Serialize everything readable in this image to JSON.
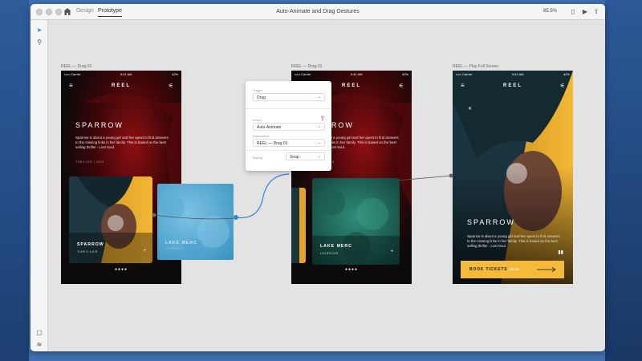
{
  "window": {
    "tabs": [
      {
        "label": "Design",
        "active": false
      },
      {
        "label": "Prototype",
        "active": true
      }
    ],
    "title": "Auto-Animate and Drag Gestures",
    "zoom": "85.5%"
  },
  "artboards": [
    {
      "label": "REEL — Drag 01"
    },
    {
      "label": "REEL — Drag 01"
    },
    {
      "label": "REEL — Play Full Screen"
    }
  ],
  "app": {
    "name": "REEL",
    "status_carrier": "••••• Carrier",
    "status_time": "9:41 AM",
    "status_battery": "42%",
    "hero_title": "SPARROW",
    "hero_description": "Sparrow is about a young girl and her quest to find answers to the missing links in her family. This is based on the best selling thriller - Lost Soul.",
    "hero_tag": "THRILLER | 2018",
    "cards": [
      {
        "title": "SPARROW",
        "genre": "THRILLER"
      },
      {
        "title": "LAKE MERC",
        "genre": "HORROR"
      }
    ],
    "page_dots": "●●●●",
    "book_label": "BOOK TICKETS",
    "book_time": "04:45"
  },
  "panel": {
    "trigger_label": "Trigger",
    "trigger_value": "Drag",
    "action_label": "Action",
    "action_value": "Auto-Animate",
    "destination_label": "Destination",
    "destination_value": "REEL — Drag 01",
    "easing_label": "Easing",
    "easing_value": "Snap"
  },
  "colors": {
    "accent_yellow": "#f5ba3a",
    "wire_blue": "#2f86d9"
  }
}
